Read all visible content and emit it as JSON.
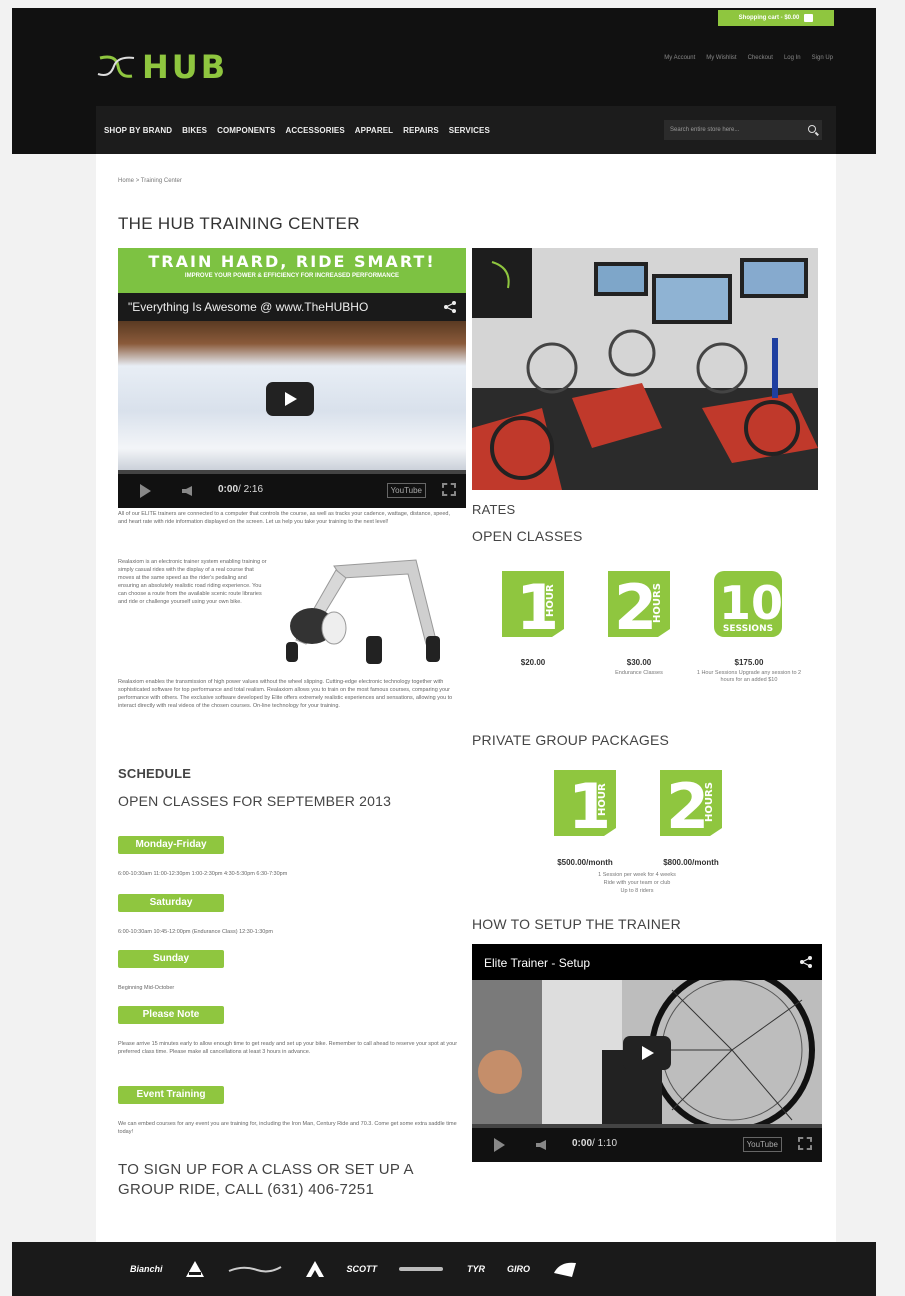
{
  "header": {
    "cart_label": "Shopping cart - $0.00",
    "logo_text": "HUB",
    "top_links": [
      "My Account",
      "My Wishlist",
      "Checkout",
      "Log In",
      "Sign Up"
    ],
    "nav": [
      "SHOP BY BRAND",
      "BIKES",
      "COMPONENTS",
      "ACCESSORIES",
      "APPAREL",
      "REPAIRS",
      "SERVICES"
    ],
    "search_placeholder": "Search entire store here..."
  },
  "breadcrumb": {
    "home": "Home",
    "sep": ">",
    "current": "Training Center"
  },
  "page_title": "THE HUB TRAINING CENTER",
  "video1": {
    "banner_line1": "TRAIN HARD, RIDE SMART!",
    "banner_line2": "IMPROVE YOUR POWER & EFFICIENCY FOR INCREASED PERFORMANCE",
    "title": "\"Everything Is Awesome @ www.TheHUBHO",
    "time_current": "0:00",
    "time_total": "/ 2:16",
    "youtube": "YouTube"
  },
  "left_text": {
    "desc1": "All of our ELITE trainers are connected to a computer that controls the course, as well as tracks your cadence, wattage, distance, speed, and heart rate with ride information displayed on the screen. Let us help you take your training to the next level!",
    "desc2": "Realaxiom is an electronic trainer system enabling training or simply casual rides with the display of a real course that moves at the same speed as the rider's pedaling and ensuring an absolutely realistic road riding experience. You can choose a route from the available scenic route libraries and ride or challenge yourself using your own bike.",
    "desc3": "Realaxiom enables the transmission of high power values without the wheel slipping. Cutting-edge electronic technology together with sophisticated software for top performance and total realism. Realaxiom allows you to train on the most famous courses, comparing your performance with others. The exclusive software developed by Elite offers extremely realistic experiences and sensations, allowing you to interact directly with real videos of the chosen courses. On-line technology for your training."
  },
  "schedule": {
    "heading": "SCHEDULE",
    "subheading": "OPEN CLASSES FOR SEPTEMBER 2013",
    "blocks": [
      {
        "label": "Monday-Friday",
        "text": "6:00-10:30am   11:00-12:30pm   1:00-2:30pm   4:30-5:30pm   6:30-7:30pm"
      },
      {
        "label": "Saturday",
        "text": "6:00-10:30am   10:45-12:00pm (Endurance Class)   12:30-1:30pm"
      },
      {
        "label": "Sunday",
        "text": "Beginning Mid-October"
      },
      {
        "label": "Please Note",
        "text": "Please arrive 15 minutes early to allow enough time to get ready and set up your bike. Remember to call ahead to reserve your spot at your preferred class time. Please make all cancellations at least 3 hours in advance."
      },
      {
        "label": "Event Training",
        "text": "We can embed courses for any event you are training for, including the Iron Man, Century Ride and 70.3. Come get some extra saddle time today!"
      }
    ]
  },
  "signup": "TO SIGN UP FOR A CLASS OR SET UP A GROUP RIDE, CALL (631) 406-7251",
  "rates": {
    "heading": "RATES",
    "open_heading": "OPEN CLASSES",
    "open": [
      {
        "big": "1",
        "side": "HOUR",
        "price": "$20.00",
        "sub": ""
      },
      {
        "big": "2",
        "side": "HOURS",
        "price": "$30.00",
        "sub": "Endurance Classes"
      },
      {
        "big": "10",
        "side": "SESSIONS",
        "price": "$175.00",
        "sub": "1 Hour Sessions Upgrade any session to 2 hours for an added $10"
      }
    ],
    "private_heading": "PRIVATE GROUP PACKAGES",
    "private": [
      {
        "big": "1",
        "side": "HOUR",
        "price": "$500.00/month"
      },
      {
        "big": "2",
        "side": "HOURS",
        "price": "$800.00/month"
      }
    ],
    "private_note": [
      "1 Session per week for 4 weeks",
      "Ride with your team or club",
      "Up to 8 riders"
    ]
  },
  "setup": {
    "heading": "HOW TO SETUP THE TRAINER",
    "video_title": "Elite Trainer - Setup",
    "time_current": "0:00",
    "time_total": "/ 1:10",
    "youtube": "YouTube"
  },
  "footer_brands": [
    "Bianchi",
    "",
    "",
    "",
    "SCOTT",
    "",
    "TYR",
    "GIRO",
    ""
  ],
  "colors": {
    "accent": "#8fc63f",
    "header_bg": "#111111"
  }
}
